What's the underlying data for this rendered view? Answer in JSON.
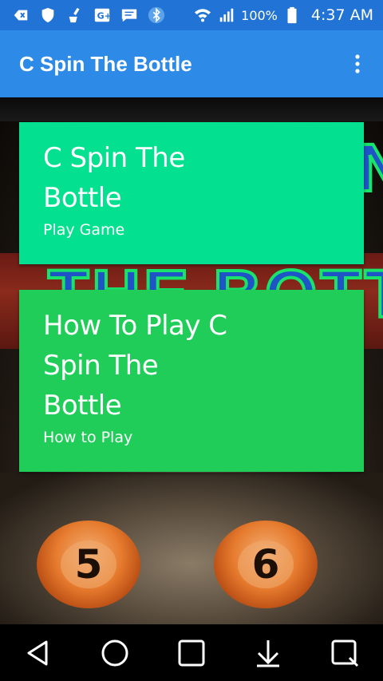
{
  "status_bar": {
    "battery": "100%",
    "time": "4:37 AM",
    "icons": [
      "back-icon",
      "shield-icon",
      "cleaner-icon",
      "google-plus-icon",
      "message-icon",
      "bluetooth-icon",
      "wifi-icon",
      "signal-icon",
      "battery-icon"
    ]
  },
  "app_bar": {
    "title": "C Spin The Bottle",
    "overflow_icon": "more-vert-icon"
  },
  "cards": [
    {
      "title": "C Spin The Bottle",
      "subtitle": "Play Game",
      "color": "#02e090"
    },
    {
      "title": "How To Play C Spin The Bottle",
      "subtitle": "How to Play",
      "color": "#1fcd58"
    }
  ],
  "background": {
    "balls": [
      "5",
      "6"
    ]
  },
  "nav_bar": {
    "buttons": [
      "back-icon",
      "home-icon",
      "recents-icon",
      "download-icon",
      "qslide-icon"
    ]
  },
  "colors": {
    "status_bar": "#2173d6",
    "app_bar": "#2d8ae6"
  }
}
